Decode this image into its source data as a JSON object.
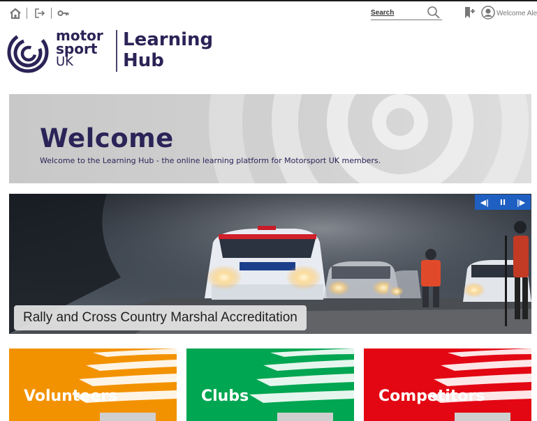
{
  "topbar": {
    "search": {
      "placeholder": "Search"
    },
    "welcome_text": "Welcome Alex",
    "icons": [
      "home-icon",
      "logout-icon",
      "key-icon",
      "search-icon",
      "bookmark-icon",
      "user-avatar-icon"
    ]
  },
  "logo": {
    "brand_lines": [
      "motor",
      "sport",
      "UK"
    ],
    "product_lines": [
      "Learning",
      "Hub"
    ]
  },
  "banner": {
    "title": "Welcome",
    "subtitle": "Welcome to the Learning Hub - the online learning platform for Motorsport UK members."
  },
  "carousel": {
    "caption": "Rally and Cross Country Marshal Accreditation",
    "controls": {
      "prev": "◀|",
      "pause": "II",
      "next": "|▶"
    }
  },
  "tiles": [
    {
      "label": "Volunteers",
      "color": "#f39200"
    },
    {
      "label": "Clubs",
      "color": "#00a651"
    },
    {
      "label": "Competitors",
      "color": "#e30613"
    }
  ],
  "colors": {
    "brand_navy": "#2b2356",
    "carousel_controls": "#1f5fc2"
  }
}
